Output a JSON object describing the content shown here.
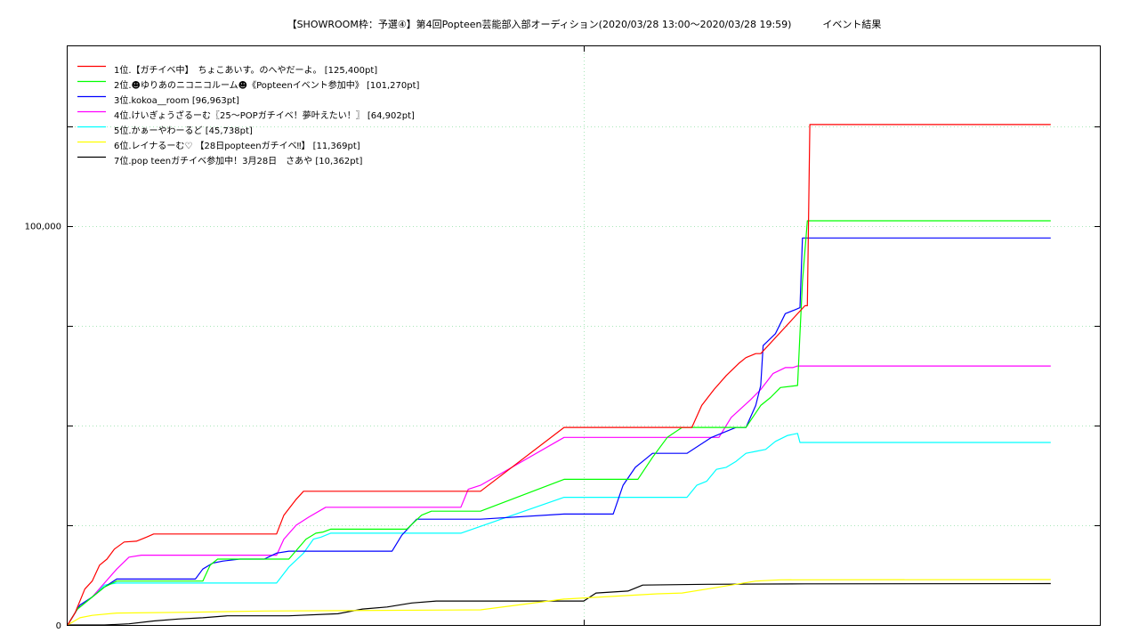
{
  "chart_data": {
    "type": "line",
    "title": "【SHOWROOM枠：予選④】第4回Popteen芸能部入部オーディション(2020/03/28 13:00～2020/03/28 19:59)          イベント結果",
    "xlabel": "",
    "ylabel": "",
    "ylim": [
      0,
      145000
    ],
    "xlim": [
      0,
      420
    ],
    "yticks": [
      {
        "value": 0,
        "label": "0"
      },
      {
        "value": 100000,
        "label": "100,000"
      }
    ],
    "grid": true,
    "legend_position": "top-left",
    "series": [
      {
        "name": "1位.【ガチイベ中】　ちょこあいす。のへやだーよ。 [125,400pt]",
        "color": "#ff0000",
        "points": [
          [
            0,
            0
          ],
          [
            3,
            3000
          ],
          [
            7,
            9000
          ],
          [
            10,
            11000
          ],
          [
            13,
            15000
          ],
          [
            16,
            16500
          ],
          [
            19,
            19000
          ],
          [
            23,
            20800
          ],
          [
            28,
            21000
          ],
          [
            32,
            22000
          ],
          [
            35,
            22800
          ],
          [
            85,
            22800
          ],
          [
            88,
            27500
          ],
          [
            93,
            31500
          ],
          [
            96,
            33500
          ],
          [
            168,
            33500
          ],
          [
            202,
            49500
          ],
          [
            254,
            49500
          ],
          [
            258,
            55000
          ],
          [
            263,
            59000
          ],
          [
            268,
            62500
          ],
          [
            273,
            65500
          ],
          [
            276,
            67000
          ],
          [
            280,
            68000
          ],
          [
            282,
            68000
          ],
          [
            300,
            80000
          ],
          [
            301,
            80000
          ],
          [
            302,
            125400
          ],
          [
            400,
            125400
          ]
        ]
      },
      {
        "name": "2位.☻ゆりあのニコニコルーム☻《Popteenイベント参加中》 [101,270pt]",
        "color": "#00ff00",
        "points": [
          [
            0,
            0
          ],
          [
            4,
            4000
          ],
          [
            10,
            7000
          ],
          [
            15,
            9500
          ],
          [
            20,
            11000
          ],
          [
            55,
            11000
          ],
          [
            58,
            15000
          ],
          [
            61,
            16500
          ],
          [
            90,
            16500
          ],
          [
            97,
            21500
          ],
          [
            101,
            23000
          ],
          [
            104,
            23300
          ],
          [
            107,
            24000
          ],
          [
            138,
            24000
          ],
          [
            144,
            27500
          ],
          [
            148,
            28500
          ],
          [
            168,
            28500
          ],
          [
            202,
            36500
          ],
          [
            232,
            36500
          ],
          [
            238,
            42000
          ],
          [
            244,
            47000
          ],
          [
            250,
            49500
          ],
          [
            276,
            49500
          ],
          [
            282,
            55000
          ],
          [
            286,
            57000
          ],
          [
            290,
            59500
          ],
          [
            297,
            60000
          ],
          [
            298,
            73000
          ],
          [
            299,
            86000
          ],
          [
            301,
            101270
          ],
          [
            400,
            101270
          ]
        ]
      },
      {
        "name": "3位.kokoa__room [96,963pt]",
        "color": "#0000ff",
        "points": [
          [
            0,
            0
          ],
          [
            5,
            5000
          ],
          [
            10,
            7000
          ],
          [
            15,
            9500
          ],
          [
            20,
            11500
          ],
          [
            52,
            11500
          ],
          [
            55,
            14000
          ],
          [
            59,
            15500
          ],
          [
            63,
            16000
          ],
          [
            70,
            16500
          ],
          [
            80,
            16500
          ],
          [
            85,
            18000
          ],
          [
            90,
            18500
          ],
          [
            132,
            18500
          ],
          [
            136,
            22500
          ],
          [
            142,
            26500
          ],
          [
            168,
            26500
          ],
          [
            202,
            27800
          ],
          [
            222,
            27800
          ],
          [
            226,
            35000
          ],
          [
            231,
            39500
          ],
          [
            234,
            41000
          ],
          [
            238,
            43000
          ],
          [
            252,
            43000
          ],
          [
            262,
            47000
          ],
          [
            272,
            49500
          ],
          [
            276,
            49500
          ],
          [
            280,
            55000
          ],
          [
            282,
            60000
          ],
          [
            283,
            70000
          ],
          [
            288,
            73000
          ],
          [
            292,
            78000
          ],
          [
            296,
            79000
          ],
          [
            298,
            79500
          ],
          [
            299,
            96963
          ],
          [
            400,
            96963
          ]
        ]
      },
      {
        "name": "4位.けいぎょうざるーむ〖25〜POPガチイベ！夢叶えたい！〗 [64,902pt]",
        "color": "#ff00ff",
        "points": [
          [
            0,
            0
          ],
          [
            4,
            4000
          ],
          [
            10,
            7000
          ],
          [
            15,
            10500
          ],
          [
            20,
            14000
          ],
          [
            25,
            17000
          ],
          [
            30,
            17500
          ],
          [
            85,
            17500
          ],
          [
            88,
            21500
          ],
          [
            93,
            25000
          ],
          [
            98,
            27000
          ],
          [
            105,
            29500
          ],
          [
            160,
            29500
          ],
          [
            163,
            34000
          ],
          [
            168,
            35000
          ],
          [
            202,
            47000
          ],
          [
            265,
            47000
          ],
          [
            270,
            52000
          ],
          [
            278,
            56500
          ],
          [
            282,
            59000
          ],
          [
            287,
            63000
          ],
          [
            292,
            64500
          ],
          [
            295,
            64500
          ],
          [
            297,
            64902
          ],
          [
            400,
            64902
          ]
        ]
      },
      {
        "name": "5位.かぁーやわーるど [45,738pt]",
        "color": "#00ffff",
        "points": [
          [
            0,
            0
          ],
          [
            4,
            4000
          ],
          [
            10,
            7000
          ],
          [
            15,
            10000
          ],
          [
            20,
            10500
          ],
          [
            85,
            10500
          ],
          [
            90,
            14500
          ],
          [
            96,
            18000
          ],
          [
            100,
            21500
          ],
          [
            103,
            22000
          ],
          [
            107,
            23000
          ],
          [
            160,
            23000
          ],
          [
            202,
            32000
          ],
          [
            252,
            32000
          ],
          [
            256,
            35000
          ],
          [
            260,
            36000
          ],
          [
            264,
            39000
          ],
          [
            268,
            39500
          ],
          [
            272,
            41000
          ],
          [
            276,
            43000
          ],
          [
            280,
            43500
          ],
          [
            284,
            44000
          ],
          [
            288,
            46000
          ],
          [
            293,
            47500
          ],
          [
            297,
            48000
          ],
          [
            298,
            45738
          ],
          [
            400,
            45738
          ]
        ]
      },
      {
        "name": "6位.レイナるーむ♡ 【28日popteenガチイベ‼】 [11,369pt]",
        "color": "#ffff00",
        "points": [
          [
            0,
            0
          ],
          [
            5,
            1800
          ],
          [
            10,
            2400
          ],
          [
            20,
            3000
          ],
          [
            50,
            3200
          ],
          [
            80,
            3500
          ],
          [
            168,
            3800
          ],
          [
            202,
            6500
          ],
          [
            240,
            7800
          ],
          [
            250,
            8000
          ],
          [
            260,
            9000
          ],
          [
            280,
            11000
          ],
          [
            290,
            11300
          ],
          [
            400,
            11369
          ]
        ]
      },
      {
        "name": "7位.pop teenガチイベ参加中！3月28日　さあや [10,362pt]",
        "color": "#000000",
        "points": [
          [
            0,
            0
          ],
          [
            15,
            0
          ],
          [
            25,
            300
          ],
          [
            35,
            1000
          ],
          [
            45,
            1500
          ],
          [
            55,
            1800
          ],
          [
            65,
            2300
          ],
          [
            90,
            2300
          ],
          [
            110,
            2800
          ],
          [
            120,
            4000
          ],
          [
            130,
            4500
          ],
          [
            140,
            5500
          ],
          [
            150,
            6000
          ],
          [
            168,
            6000
          ],
          [
            210,
            6000
          ],
          [
            215,
            8000
          ],
          [
            228,
            8500
          ],
          [
            234,
            10000
          ],
          [
            260,
            10200
          ],
          [
            300,
            10300
          ],
          [
            400,
            10362
          ]
        ]
      }
    ]
  }
}
